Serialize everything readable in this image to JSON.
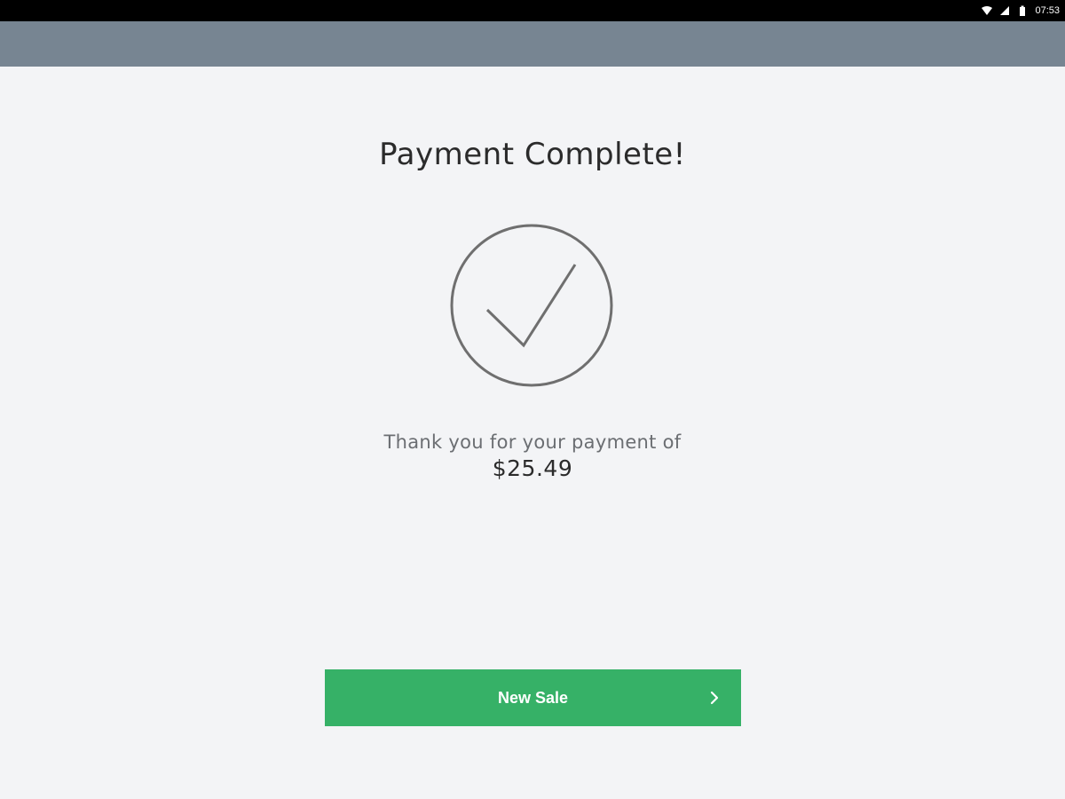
{
  "status_bar": {
    "time": "07:53",
    "icons": [
      "wifi-icon",
      "signal-icon",
      "battery-icon"
    ]
  },
  "main": {
    "title": "Payment Complete!",
    "status_icon": "checkmark-circle-icon",
    "message": "Thank you for your payment of",
    "amount": "$25.49"
  },
  "actions": {
    "new_sale_label": "New Sale",
    "new_sale_icon": "chevron-right-icon"
  },
  "colors": {
    "app_bar": "#778592",
    "background": "#f3f4f6",
    "button": "#36b167",
    "status_bar": "#000000"
  }
}
